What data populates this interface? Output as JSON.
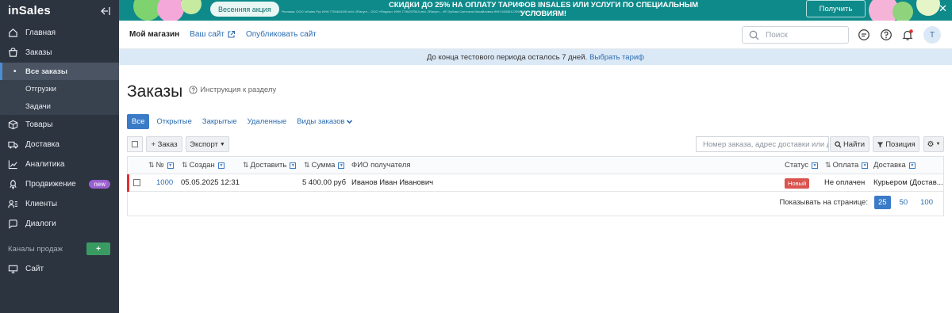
{
  "sidebar": {
    "logo": "inSales",
    "nav": [
      {
        "label": "Главная",
        "icon": "home-icon"
      },
      {
        "label": "Заказы",
        "icon": "bag-icon"
      }
    ],
    "orders_sub": [
      "Все заказы",
      "Отгрузки",
      "Задачи"
    ],
    "nav2": [
      {
        "label": "Товары",
        "icon": "box-icon"
      },
      {
        "label": "Доставка",
        "icon": "truck-icon"
      },
      {
        "label": "Аналитика",
        "icon": "chart-icon"
      },
      {
        "label": "Продвижение",
        "icon": "rocket-icon",
        "badge": "new"
      },
      {
        "label": "Клиенты",
        "icon": "users-icon"
      },
      {
        "label": "Диалоги",
        "icon": "chat-icon"
      }
    ],
    "channels_label": "Каналы продаж",
    "channels_add": "+",
    "site_label": "Сайт"
  },
  "banner": {
    "promo": "Весенняя акция",
    "title": "СКИДКИ ДО 25% НА ОПЛАТУ ТАРИФОВ INSALES ИЛИ УСЛУГИ ПО СПЕЦИАЛЬНЫМ УСЛОВИЯМ!",
    "fine_print": "Реклама. ООО InSales Рус ИНН 7704844390 erid: 2Ranym... ООО «Яндекс» ИНН 7736207543 erid: 2Ranym... ИП Зубова Светлана Михайловна ИНН 540351278985 erid: 2Ranym...",
    "cta": "Получить"
  },
  "header": {
    "store": "Мой магазин",
    "your_site": "Ваш сайт",
    "publish": "Опубликовать сайт",
    "search_placeholder": "Поиск",
    "avatar": "T"
  },
  "trial": {
    "text": "До конца тестового периода осталось 7 дней.",
    "link": "Выбрать тариф"
  },
  "page": {
    "title": "Заказы",
    "help": "Инструкция к разделу"
  },
  "tabs": [
    "Все",
    "Открытые",
    "Закрытые",
    "Удаленные",
    "Виды заказов"
  ],
  "toolbar": {
    "add_order": "+ Заказ",
    "export": "Экспорт",
    "search_placeholder": "Номер заказа, адрес доставки или да",
    "find": "Найти",
    "position": "Позиция"
  },
  "table": {
    "columns": {
      "number": "№",
      "created": "Создан",
      "deliver": "Доставить",
      "sum": "Сумма",
      "recipient": "ФИО получателя",
      "status": "Статус",
      "payment": "Оплата",
      "delivery": "Доставка"
    },
    "rows": [
      {
        "number": "1000",
        "created": "05.05.2025 12:31",
        "sum": "5 400.00 руб",
        "recipient": "Иванов Иван Иванович",
        "status": "Новый",
        "payment": "Не оплачен",
        "delivery": "Курьером (Достав..."
      }
    ]
  },
  "pager": {
    "label": "Показывать на странице:",
    "sizes": [
      "25",
      "50",
      "100"
    ],
    "selected": "25"
  },
  "colors": {
    "sidebar_bg": "#2c3440",
    "banner_bg": "#0e8a8a",
    "accent": "#3a7bc8",
    "link": "#2b6cb0",
    "status_new": "#d9534f",
    "new_badge": "#9b5fd0",
    "add_channel": "#3a9b62"
  }
}
